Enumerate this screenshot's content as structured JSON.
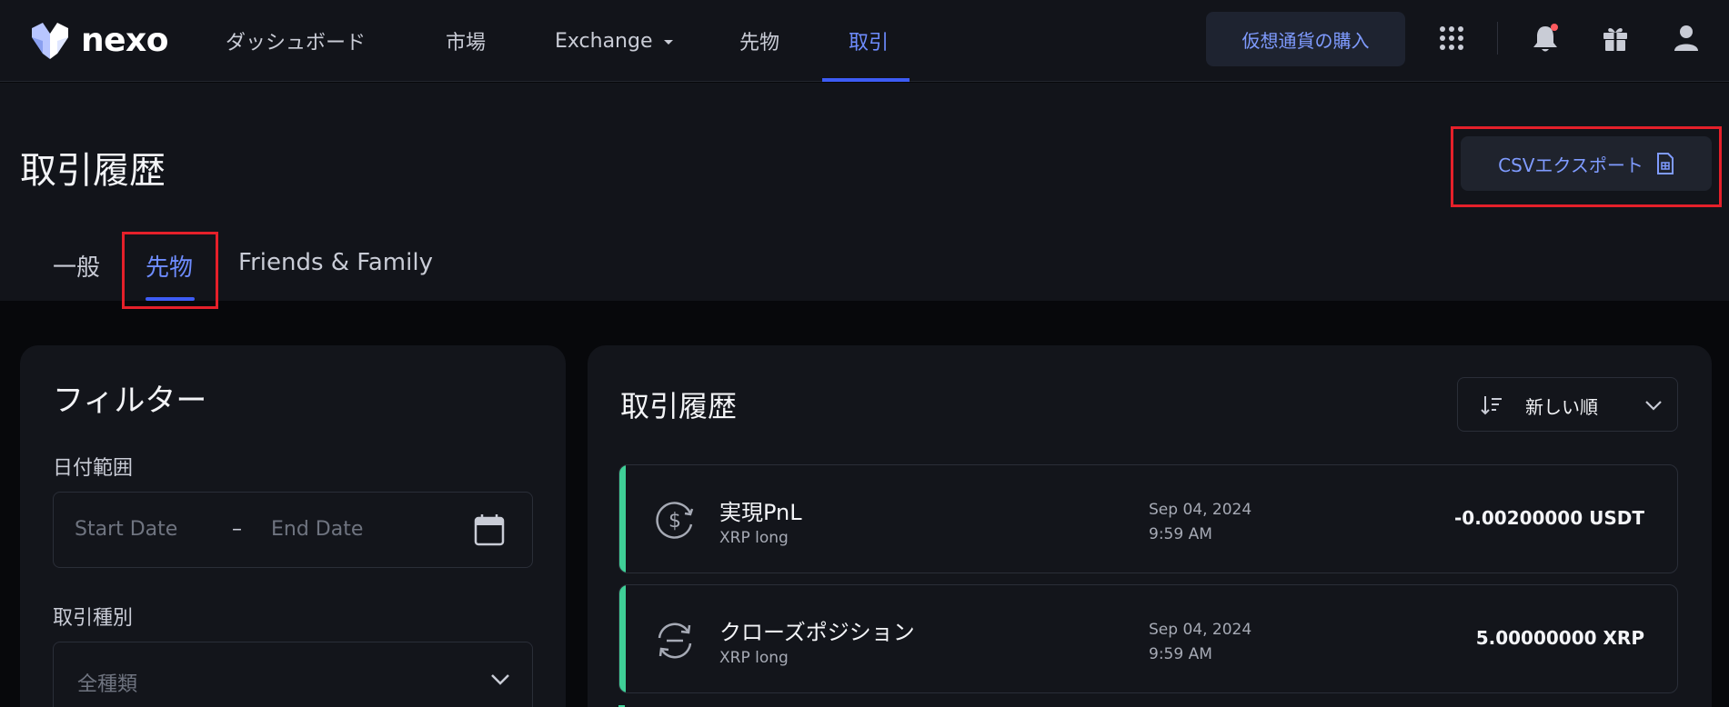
{
  "brand": {
    "name": "nexo"
  },
  "nav": {
    "items": [
      {
        "label": "ダッシュボード"
      },
      {
        "label": "市場"
      },
      {
        "label": "Exchange"
      },
      {
        "label": "先物"
      },
      {
        "label": "取引"
      }
    ],
    "buy_label": "仮想通貨の購入",
    "icons": [
      "apps-grid-icon",
      "bell-icon",
      "gift-icon",
      "user-icon"
    ],
    "accent_color": "#3d5cf5",
    "notification_dot_color": "#ff5a5f"
  },
  "page": {
    "title": "取引履歴",
    "csv_label": "CSVエクスポート",
    "tabs": [
      {
        "label": "一般"
      },
      {
        "label": "先物"
      },
      {
        "label": "Friends & Family"
      }
    ]
  },
  "filters": {
    "title": "フィルター",
    "date_range_label": "日付範囲",
    "start_placeholder": "Start Date",
    "dash": "–",
    "end_placeholder": "End Date",
    "type_label": "取引種別",
    "type_value": "全種類"
  },
  "history": {
    "title": "取引履歴",
    "sort_label": "新しい順",
    "rows": [
      {
        "title": "実現PnL",
        "sub": "XRP long",
        "date": "Sep 04, 2024",
        "time": "9:59 AM",
        "amount": "-0.00200000 USDT",
        "icon": "dollar-coin-icon"
      },
      {
        "title": "クローズポジション",
        "sub": "XRP long",
        "date": "Sep 04, 2024",
        "time": "9:59 AM",
        "amount": "5.00000000 XRP",
        "icon": "swap-cycle-icon"
      }
    ],
    "row_accent_color": "#3fcf97"
  },
  "highlight_color": "#e5202a"
}
